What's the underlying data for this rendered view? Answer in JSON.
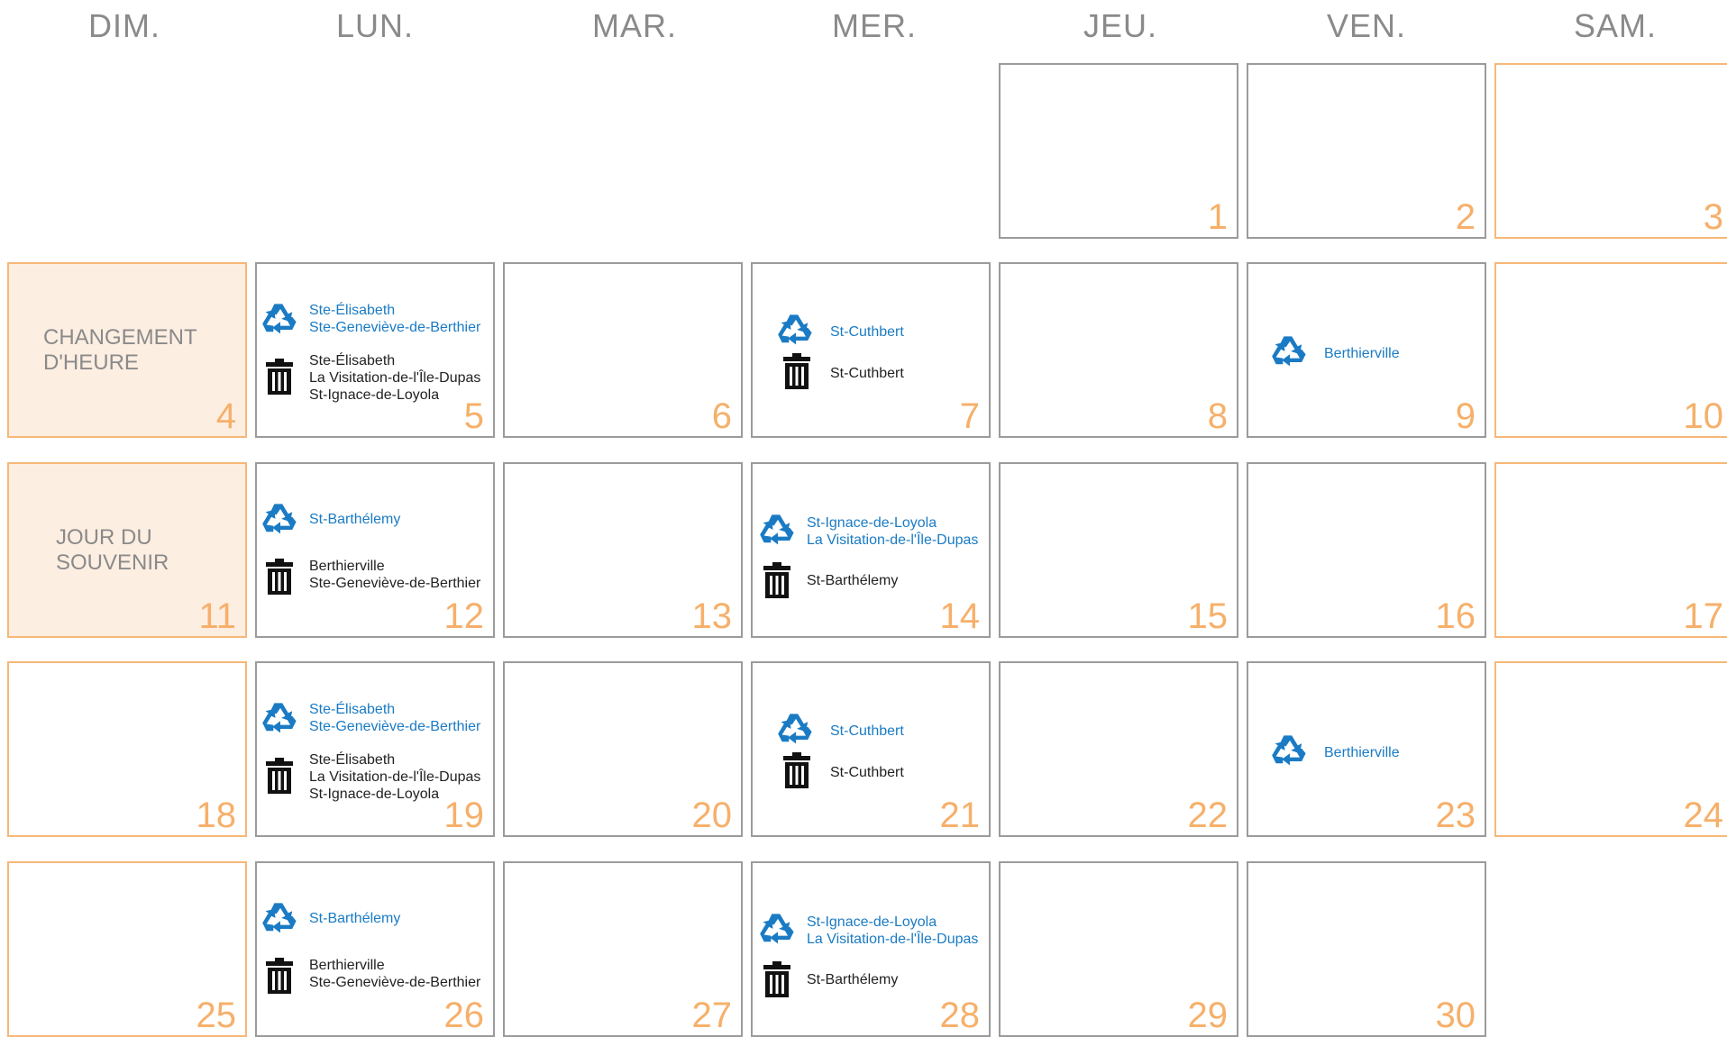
{
  "headers": [
    "DIM.",
    "LUN.",
    "MAR.",
    "MER.",
    "JEU.",
    "VEN.",
    "SAM."
  ],
  "colors": {
    "accent": "#f6b06a",
    "weekend_border": "#f6b878",
    "holiday_bg": "#fdeee2",
    "recycle": "#1a7bc4",
    "trash": "#222222",
    "border": "#9b9b9b",
    "header": "#8a8a8a"
  },
  "cells": {
    "d1": {
      "num": "1"
    },
    "d2": {
      "num": "2"
    },
    "d3": {
      "num": "3"
    },
    "d4": {
      "num": "4",
      "note": [
        "CHANGEMENT",
        "D'HEURE"
      ]
    },
    "d5": {
      "num": "5",
      "recycle": [
        "Ste-Élisabeth",
        "Ste-Geneviève-de-Berthier"
      ],
      "trash": [
        "Ste-Élisabeth",
        "La Visitation-de-l'Île-Dupas",
        "St-Ignace-de-Loyola"
      ]
    },
    "d6": {
      "num": "6"
    },
    "d7": {
      "num": "7",
      "recycle": [
        "St-Cuthbert"
      ],
      "trash": [
        "St-Cuthbert"
      ]
    },
    "d8": {
      "num": "8"
    },
    "d9": {
      "num": "9",
      "recycle": [
        "Berthierville"
      ]
    },
    "d10": {
      "num": "10"
    },
    "d11": {
      "num": "11",
      "note": [
        "JOUR DU",
        "SOUVENIR"
      ]
    },
    "d12": {
      "num": "12",
      "recycle": [
        "St-Barthélemy"
      ],
      "trash": [
        "Berthierville",
        "Ste-Geneviève-de-Berthier"
      ]
    },
    "d13": {
      "num": "13"
    },
    "d14": {
      "num": "14",
      "recycle": [
        "St-Ignace-de-Loyola",
        "La Visitation-de-l'Île-Dupas"
      ],
      "trash": [
        "St-Barthélemy"
      ]
    },
    "d15": {
      "num": "15"
    },
    "d16": {
      "num": "16"
    },
    "d17": {
      "num": "17"
    },
    "d18": {
      "num": "18"
    },
    "d19": {
      "num": "19",
      "recycle": [
        "Ste-Élisabeth",
        "Ste-Geneviève-de-Berthier"
      ],
      "trash": [
        "Ste-Élisabeth",
        "La Visitation-de-l'Île-Dupas",
        "St-Ignace-de-Loyola"
      ]
    },
    "d20": {
      "num": "20"
    },
    "d21": {
      "num": "21",
      "recycle": [
        "St-Cuthbert"
      ],
      "trash": [
        "St-Cuthbert"
      ]
    },
    "d22": {
      "num": "22"
    },
    "d23": {
      "num": "23",
      "recycle": [
        "Berthierville"
      ]
    },
    "d24": {
      "num": "24"
    },
    "d25": {
      "num": "25"
    },
    "d26": {
      "num": "26",
      "recycle": [
        "St-Barthélemy"
      ],
      "trash": [
        "Berthierville",
        "Ste-Geneviève-de-Berthier"
      ]
    },
    "d27": {
      "num": "27"
    },
    "d28": {
      "num": "28",
      "recycle": [
        "St-Ignace-de-Loyola",
        "La Visitation-de-l'Île-Dupas"
      ],
      "trash": [
        "St-Barthélemy"
      ]
    },
    "d29": {
      "num": "29"
    },
    "d30": {
      "num": "30"
    }
  }
}
